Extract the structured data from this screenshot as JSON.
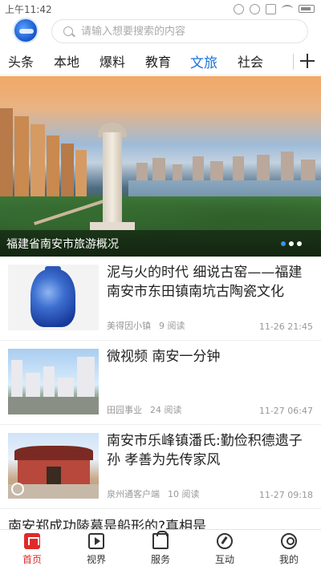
{
  "status_bar": {
    "time": "上午11:42"
  },
  "search": {
    "placeholder": "请输入想要搜索的内容"
  },
  "tabs": [
    {
      "label": "头条"
    },
    {
      "label": "本地"
    },
    {
      "label": "爆料"
    },
    {
      "label": "教育"
    },
    {
      "label": "文旅",
      "active": true
    },
    {
      "label": "社会"
    }
  ],
  "banner": {
    "caption": "福建省南安市旅游概况",
    "slide_count": 3,
    "active_slide": 1
  },
  "news": [
    {
      "title": "泥与火的时代 细说古窑——福建南安市东田镇南坑古陶瓷文化",
      "source": "美得因小镇",
      "reads": "9 阅读",
      "time": "11-26 21:45"
    },
    {
      "title": "微视频 南安一分钟",
      "source": "田园事业",
      "reads": "24 阅读",
      "time": "11-27 06:47"
    },
    {
      "title": "南安市乐峰镇潘氏:勤俭积德遗子孙 孝善为先传家风",
      "source": "泉州通客户端",
      "reads": "10 阅读",
      "time": "11-27 09:18"
    },
    {
      "title": "南安郑成功陵墓是船形的?真相是"
    }
  ],
  "bottom_nav": [
    {
      "label": "首页",
      "icon": "home-icon",
      "active": true
    },
    {
      "label": "视界",
      "icon": "video-icon"
    },
    {
      "label": "服务",
      "icon": "service-icon"
    },
    {
      "label": "互动",
      "icon": "compass-icon"
    },
    {
      "label": "我的",
      "icon": "user-icon"
    }
  ],
  "colors": {
    "accent": "#1a73d9",
    "nav_active": "#e02a2a"
  }
}
